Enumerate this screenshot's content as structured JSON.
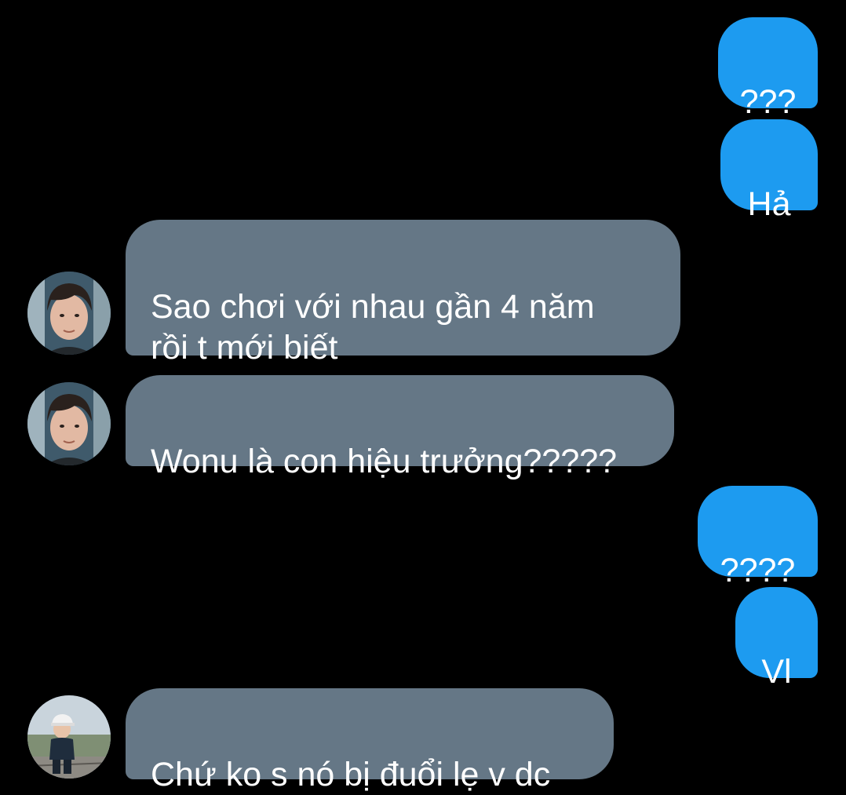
{
  "colors": {
    "background": "#000000",
    "outgoing_bubble": "#1d9bf0",
    "incoming_bubble": "#657786",
    "text": "#ffffff"
  },
  "messages": [
    {
      "direction": "outgoing",
      "text": "???"
    },
    {
      "direction": "outgoing",
      "text": "Hả"
    },
    {
      "direction": "incoming",
      "avatar": "avatar-young-man-dark-hair",
      "text": "Sao chơi với nhau gần 4 năm\nrồi t mới biết"
    },
    {
      "direction": "incoming",
      "avatar": "avatar-young-man-dark-hair",
      "text": "Wonu là con hiệu trưởng?????"
    },
    {
      "direction": "outgoing",
      "text": "????"
    },
    {
      "direction": "outgoing",
      "text": "Vl"
    },
    {
      "direction": "incoming",
      "avatar": "avatar-child-with-cap-outdoors",
      "text": "Chứ ko s nó bị đuổi lẹ v dc"
    }
  ]
}
